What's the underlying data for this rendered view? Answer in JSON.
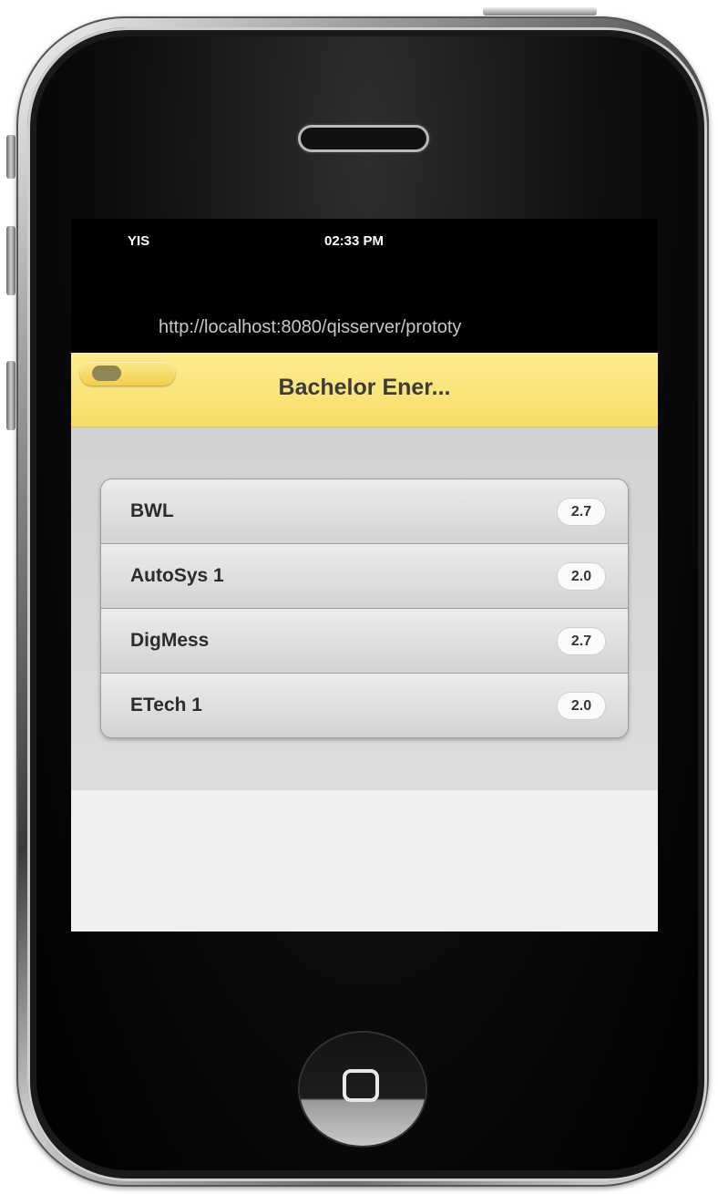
{
  "status_bar": {
    "carrier": "YIS",
    "time": "02:33 PM"
  },
  "browser": {
    "url": "http://localhost:8080/qisserver/prototy"
  },
  "header": {
    "title": "Bachelor Ener..."
  },
  "list": {
    "items": [
      {
        "label": "BWL",
        "grade": "2.7"
      },
      {
        "label": "AutoSys 1",
        "grade": "2.0"
      },
      {
        "label": "DigMess",
        "grade": "2.7"
      },
      {
        "label": "ETech 1",
        "grade": "2.0"
      }
    ]
  },
  "colors": {
    "header_background": "#f7dd67",
    "content_background": "#d6d6d6",
    "frame_black": "#000000"
  },
  "icons": {
    "home_button": "home-square-icon"
  }
}
